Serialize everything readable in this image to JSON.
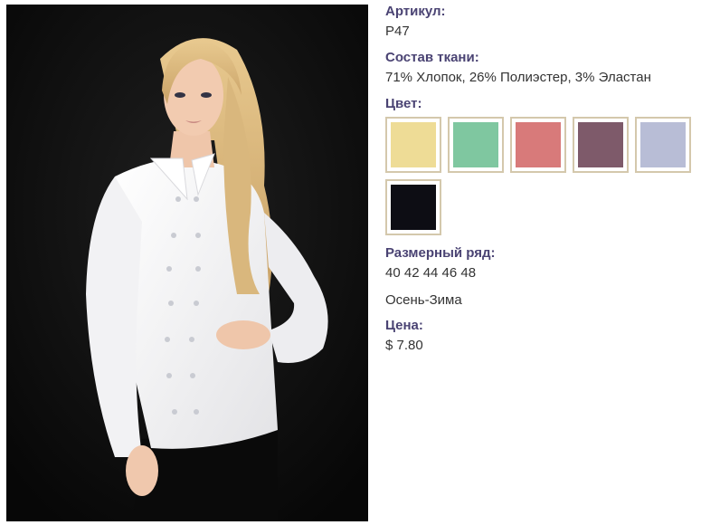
{
  "product": {
    "sku_label": "Артикул:",
    "sku_value": "P47",
    "fabric_label": "Состав ткани:",
    "fabric_value": "71% Хлопок, 26% Полиэстер, 3% Эластан",
    "color_label": "Цвет:",
    "colors": [
      {
        "name": "yellow-swatch",
        "hex": "#eedc96"
      },
      {
        "name": "mint-swatch",
        "hex": "#7fc7a0"
      },
      {
        "name": "pink-swatch",
        "hex": "#d87a7a"
      },
      {
        "name": "mauve-swatch",
        "hex": "#7e5a6a"
      },
      {
        "name": "lavender-swatch",
        "hex": "#b8bdd6"
      },
      {
        "name": "black-swatch",
        "hex": "#0d0d14"
      }
    ],
    "sizes_label": "Размерный ряд:",
    "sizes_value": "40 42 44 46 48",
    "season_value": "Осень-Зима",
    "price_label": "Цена:",
    "price_value": "$ 7.80"
  },
  "colors": {
    "label_color": "#4a4373",
    "text_color": "#333333",
    "swatch_border": "#d4c8ac",
    "photo_background": "#111111"
  }
}
